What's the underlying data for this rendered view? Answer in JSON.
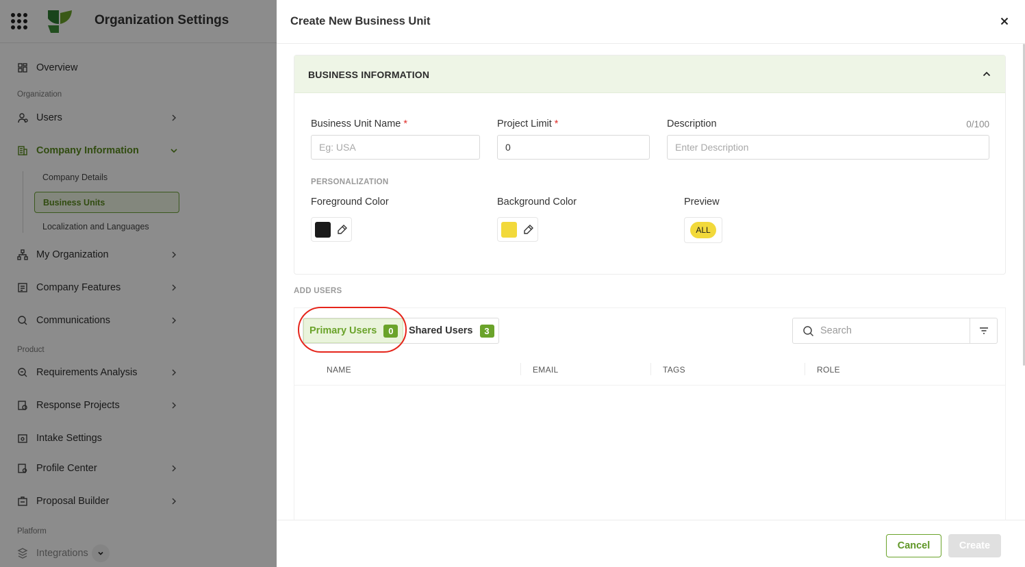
{
  "app": {
    "title": "Organization Settings",
    "sidebar": {
      "overview": "Overview",
      "group_organization": "Organization",
      "users": "Users",
      "company_information": "Company Information",
      "sub_company_details": "Company Details",
      "sub_business_units": "Business Units",
      "sub_localization": "Localization and Languages",
      "my_organization": "My Organization",
      "company_features": "Company Features",
      "communications": "Communications",
      "group_product": "Product",
      "requirements_analysis": "Requirements Analysis",
      "response_projects": "Response Projects",
      "intake_settings": "Intake Settings",
      "profile_center": "Profile Center",
      "proposal_builder": "Proposal Builder",
      "group_platform": "Platform",
      "integrations": "Integrations"
    }
  },
  "drawer": {
    "title": "Create New Business Unit",
    "business_info": {
      "section_title": "BUSINESS INFORMATION",
      "name_label": "Business Unit Name",
      "name_placeholder": "Eg: USA",
      "project_limit_label": "Project Limit",
      "project_limit_value": "0",
      "required_mark": "*",
      "description_label": "Description",
      "description_counter": "0/100",
      "description_placeholder": "Enter Description",
      "personalization_label": "PERSONALIZATION",
      "foreground_label": "Foreground Color",
      "foreground_color": "#1a1a1a",
      "background_label": "Background Color",
      "background_color": "#f2d93b",
      "preview_label": "Preview",
      "preview_text": "ALL"
    },
    "add_users": {
      "section_label": "ADD USERS",
      "tabs": [
        {
          "label": "Primary Users",
          "count": "0"
        },
        {
          "label": "Shared Users",
          "count": "3"
        }
      ],
      "search_placeholder": "Search",
      "columns": [
        "NAME",
        "EMAIL",
        "TAGS",
        "ROLE"
      ]
    },
    "footer": {
      "cancel": "Cancel",
      "create": "Create"
    }
  },
  "colors": {
    "accent": "#6aa32a",
    "highlight": "#e5251b"
  }
}
